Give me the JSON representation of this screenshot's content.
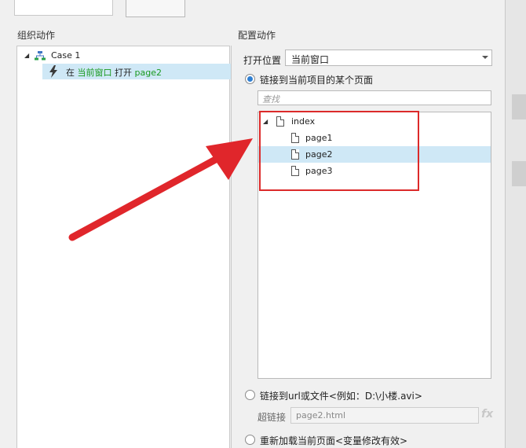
{
  "left": {
    "section_title": "组织动作",
    "case_label": "Case 1",
    "action": {
      "prefix": "在",
      "target": "当前窗口",
      "verb": "打开",
      "page": "page2"
    }
  },
  "right": {
    "section_title": "配置动作",
    "open_location_label": "打开位置",
    "open_location_value": "当前窗口",
    "radio_link_page": "链接到当前项目的某个页面",
    "search_placeholder": "查找",
    "tree": {
      "root": "index",
      "children": [
        "page1",
        "page2",
        "page3"
      ]
    },
    "radio_link_url": "链接到url或文件<例如：D:\\小楼.avi>",
    "hyperlink_label": "超链接",
    "hyperlink_value": "page2.html",
    "fx_label": "fx",
    "radio_reload": "重新加载当前页面<变量修改有效>"
  },
  "colors": {
    "selection": "#cfe8f6",
    "highlight_red": "#dc2a2a",
    "arrow_red": "#e0262b",
    "action_green": "#1a9a20",
    "radio_blue": "#2f7fd2"
  }
}
